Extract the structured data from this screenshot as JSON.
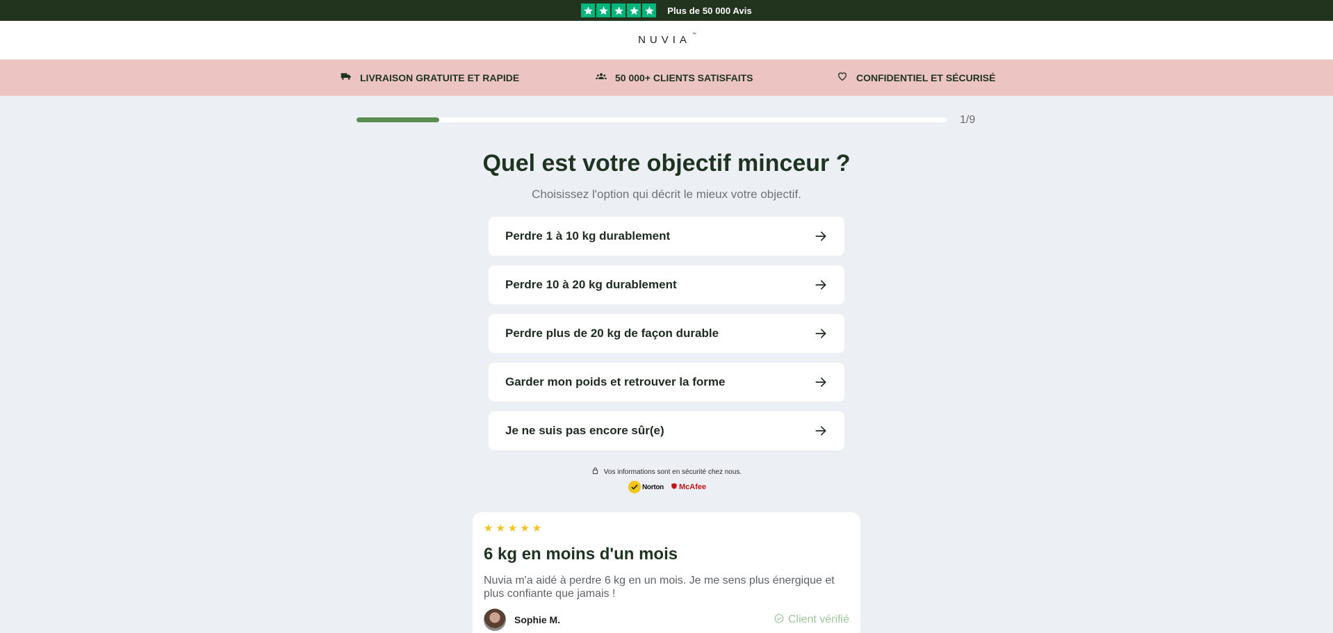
{
  "topbar": {
    "rating_stars": 5,
    "reviews_text": "Plus de 50 000 Avis",
    "star_color": "#00b67a"
  },
  "header": {
    "logo": "NUVIA",
    "logo_tm": "™"
  },
  "benefits": [
    {
      "icon": "truck-icon",
      "label": "LIVRAISON GRATUITE ET RAPIDE"
    },
    {
      "icon": "users-icon",
      "label": "50 000+ CLIENTS SATISFAITS"
    },
    {
      "icon": "heart-icon",
      "label": "CONFIDENTIEL ET SÉCURISÉ"
    }
  ],
  "progress": {
    "fraction": 0.14,
    "label": "1/9"
  },
  "question": {
    "title": "Quel est votre objectif minceur ?",
    "subtitle": "Choisissez l'option qui décrit le mieux votre objectif."
  },
  "options": [
    "Perdre 1 à 10 kg durablement",
    "Perdre 10 à 20 kg durablement",
    "Perdre plus de 20 kg de façon durable",
    "Garder mon poids et retrouver la forme",
    "Je ne suis pas encore sûr(e)"
  ],
  "security": {
    "text": "Vos informations sont en sécurité chez nous.",
    "norton": "Norton",
    "mcafee": "McAfee"
  },
  "review": {
    "stars": 5,
    "title": "6 kg en moins d'un mois",
    "text": "Nuvia m'a aidé à perdre 6 kg en un mois. Je me sens plus énergique et plus confiante que jamais !",
    "author": "Sophie M.",
    "verified": "Client vérifié"
  },
  "colors": {
    "dark_green": "#22331e",
    "accent_green": "#5b8c52",
    "pink_band": "#ecc4c1",
    "background": "#eceff3"
  }
}
